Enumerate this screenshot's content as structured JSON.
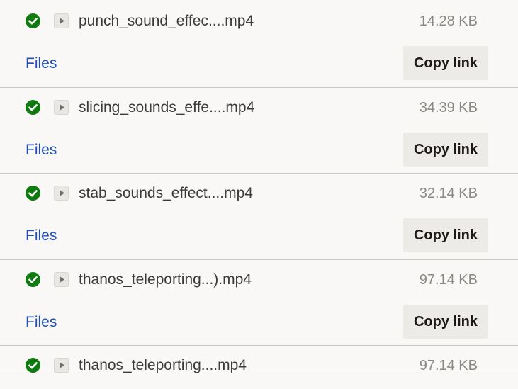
{
  "files": [
    {
      "name": "punch_sound_effec....mp4",
      "size": "14.28 KB",
      "link_label": "Files",
      "button_label": "Copy link"
    },
    {
      "name": "slicing_sounds_effe....mp4",
      "size": "34.39 KB",
      "link_label": "Files",
      "button_label": "Copy link"
    },
    {
      "name": "stab_sounds_effect....mp4",
      "size": "32.14 KB",
      "link_label": "Files",
      "button_label": "Copy link"
    },
    {
      "name": "thanos_teleporting...).mp4",
      "size": "97.14 KB",
      "link_label": "Files",
      "button_label": "Copy link"
    },
    {
      "name": "thanos_teleporting....mp4",
      "size": "97.14 KB"
    }
  ],
  "icons": {
    "status": "check-circle-icon",
    "preview": "play-icon",
    "status_color": "#0f7a0f",
    "link_color": "#1e4fbd"
  }
}
